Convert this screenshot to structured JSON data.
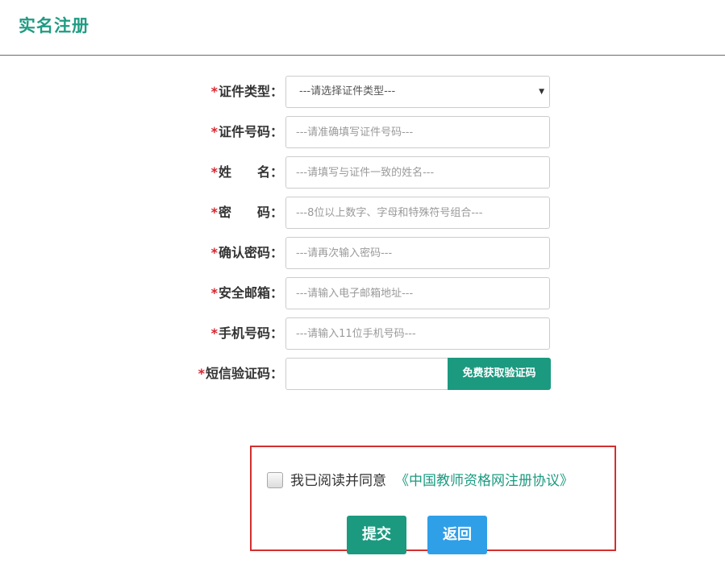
{
  "page": {
    "title": "实名注册"
  },
  "form": {
    "required_mark": "*",
    "id_type": {
      "label": "证件类型：",
      "selected": "---请选择证件类型---",
      "arrow": "▼"
    },
    "id_number": {
      "label": "证件号码：",
      "placeholder": "---请准确填写证件号码---",
      "value": ""
    },
    "name": {
      "label": "姓　　名：",
      "placeholder": "---请填写与证件一致的姓名---",
      "value": ""
    },
    "password": {
      "label": "密　　码：",
      "placeholder": "---8位以上数字、字母和特殊符号组合---",
      "value": ""
    },
    "confirm_password": {
      "label": "确认密码：",
      "placeholder": "---请再次输入密码---",
      "value": ""
    },
    "email": {
      "label": "安全邮箱：",
      "placeholder": "---请输入电子邮箱地址---",
      "value": ""
    },
    "phone": {
      "label": "手机号码：",
      "placeholder": "---请输入11位手机号码---",
      "value": ""
    },
    "sms_code": {
      "label": "短信验证码：",
      "placeholder": "",
      "value": "",
      "button_label": "免费获取验证码"
    }
  },
  "agreement": {
    "checked": false,
    "text": "我已阅读并同意",
    "link_text": "《中国教师资格网注册协议》"
  },
  "actions": {
    "submit_label": "提交",
    "back_label": "返回"
  },
  "colors": {
    "accent": "#1b9a80",
    "back_button": "#2f9fe8",
    "required": "#d9232d",
    "highlight_border": "#d32f2f"
  }
}
